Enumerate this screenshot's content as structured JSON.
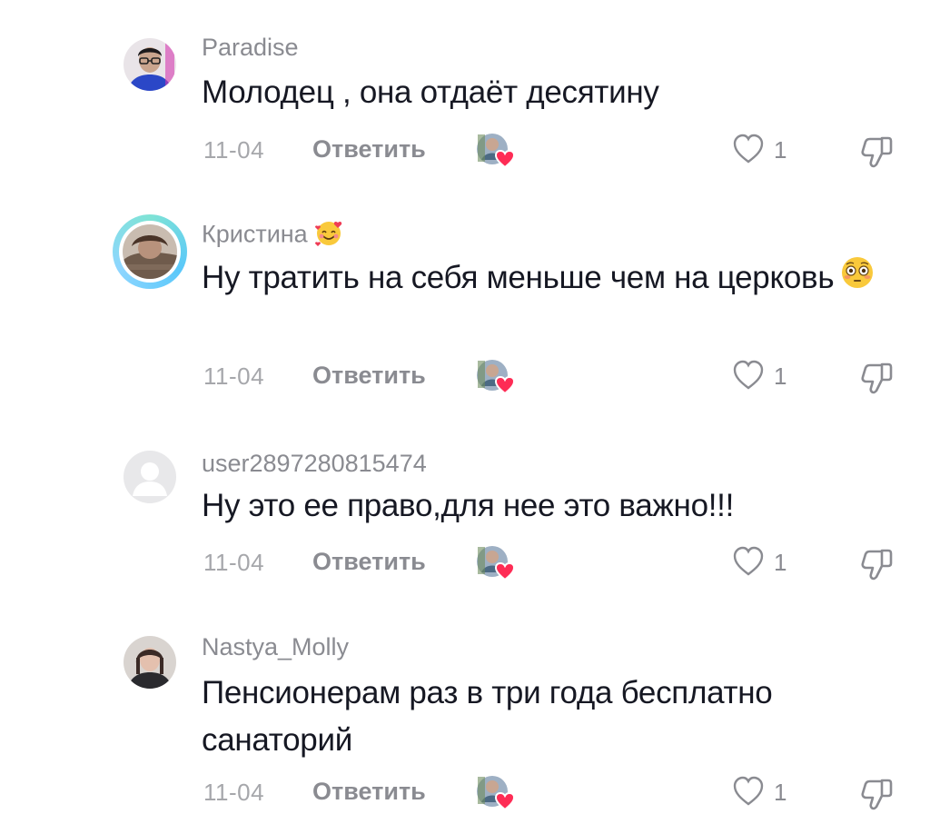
{
  "reply_label": "Ответить",
  "comments": [
    {
      "username": "Paradise",
      "text": "Молодец , она отдаёт десятину",
      "date": "11-04",
      "likes": "1",
      "avatar_icon": "person-glasses-avatar"
    },
    {
      "username": "Кристина",
      "username_emoji": "smiling-face-with-hearts-emoji",
      "text": "Ну тратить на себя меньше чем на церковь",
      "text_emoji": "flushed-face-emoji",
      "date": "11-04",
      "likes": "1",
      "avatar_icon": "photo-avatar-with-story-ring"
    },
    {
      "username": "user2897280815474",
      "text": "Ну это ее право,для нее это важно!!!",
      "date": "11-04",
      "likes": "1",
      "avatar_icon": "default-user-avatar"
    },
    {
      "username": "Nastya_Molly",
      "text": "Пенсионерам раз в три года бесплатно санаторий",
      "date": "11-04",
      "likes": "1",
      "avatar_icon": "photo-avatar"
    }
  ],
  "colors": {
    "text": "#161823",
    "secondary": "#8a8b91",
    "date": "#a6a7ab",
    "heart": "#fe2c55"
  }
}
